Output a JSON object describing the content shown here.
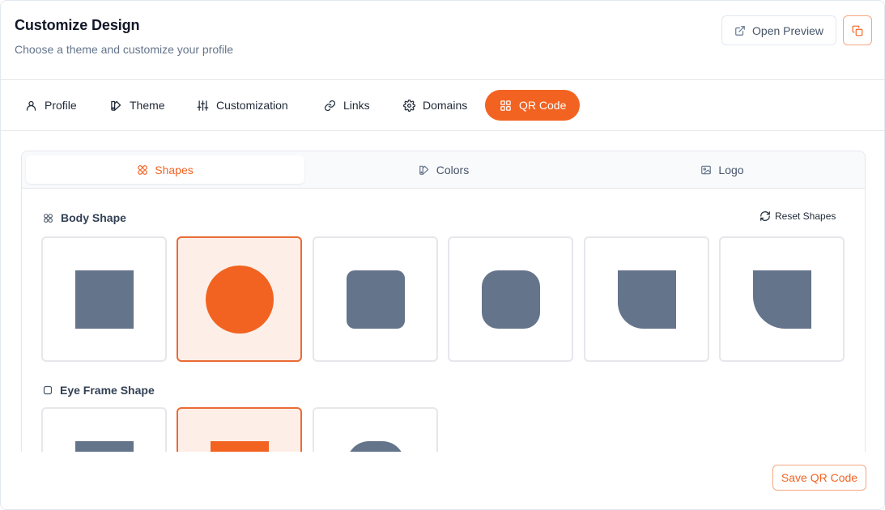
{
  "header": {
    "title": "Customize Design",
    "subtitle": "Choose a theme and customize your profile",
    "preview_label": "Open Preview"
  },
  "tabs": [
    {
      "label": "Profile",
      "icon": "user-icon"
    },
    {
      "label": "Theme",
      "icon": "palette-icon"
    },
    {
      "label": "Customization",
      "icon": "sliders-icon"
    },
    {
      "label": "Links",
      "icon": "link-icon"
    },
    {
      "label": "Domains",
      "icon": "gear-icon"
    },
    {
      "label": "QR Code",
      "icon": "qr-code-icon",
      "active": true
    }
  ],
  "subtabs": [
    {
      "label": "Shapes",
      "icon": "shapes-icon",
      "active": true
    },
    {
      "label": "Colors",
      "icon": "palette-icon"
    },
    {
      "label": "Logo",
      "icon": "image-icon"
    }
  ],
  "body_shape": {
    "label": "Body Shape",
    "reset_label": "Reset Shapes",
    "options": [
      "square",
      "circle",
      "rounded",
      "extra-rounded",
      "leaf",
      "leaf-large"
    ],
    "selected": "circle"
  },
  "eye_frame_shape": {
    "label": "Eye Frame Shape",
    "options": [
      "square",
      "square-selected",
      "rounded"
    ],
    "selected": "square-selected"
  },
  "footer": {
    "save_label": "Save QR Code"
  },
  "colors": {
    "accent": "#f26322",
    "shape": "#64748b",
    "selected_bg": "#fdefe8"
  }
}
